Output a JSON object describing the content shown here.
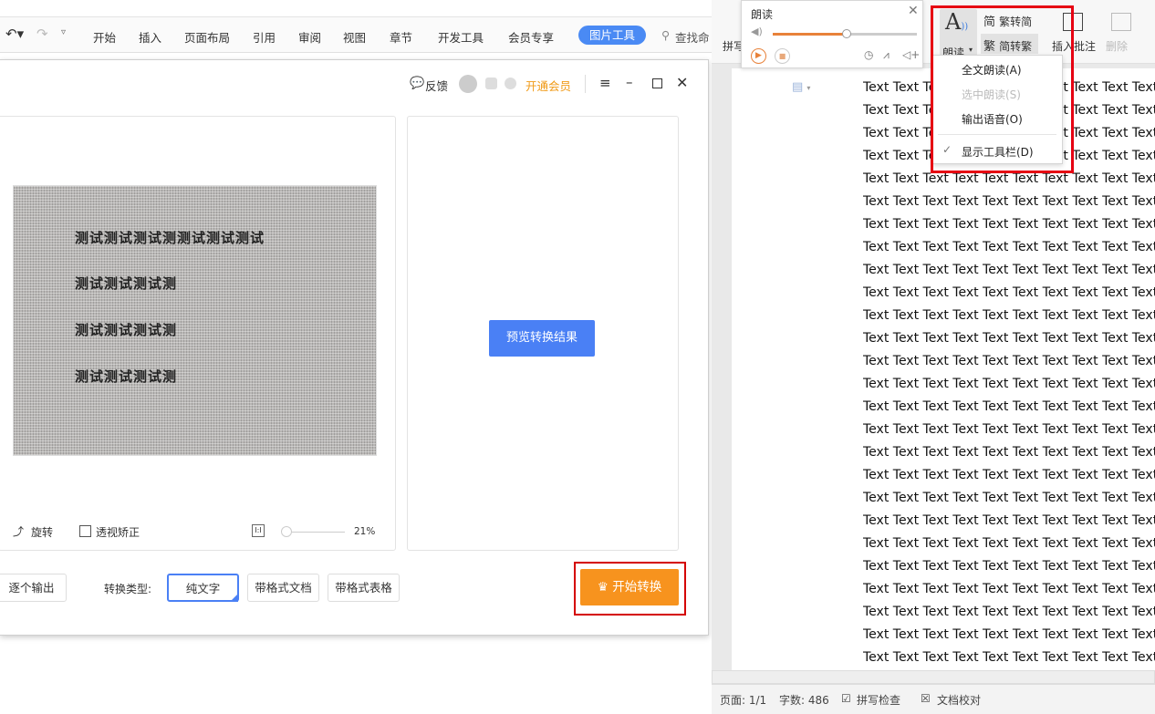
{
  "ribbon": {
    "tabs": [
      "开始",
      "插入",
      "页面布局",
      "引用",
      "审阅",
      "视图",
      "章节",
      "开发工具",
      "会员专享"
    ],
    "active_tab": "图片工具",
    "search": "查找命",
    "partial_label": "拼写"
  },
  "dialog": {
    "feedback": "反馈",
    "vip": "开通会员",
    "preview_button": "预览转换结果",
    "photo_lines": [
      "测试测试测试测测试测试测试",
      "测试测试测试测",
      "测试测试测试测",
      "测试测试测试测"
    ],
    "rotate": "旋转",
    "perspective": "透视矫正",
    "zoom": "21%",
    "export_each": "逐个输出",
    "type_label": "转换类型:",
    "types": [
      "纯文字",
      "带格式文档",
      "带格式表格"
    ],
    "selected_type": "纯文字",
    "start": "开始转换"
  },
  "read_panel": {
    "title": "朗读",
    "volume_percent": 51
  },
  "ribbon_right": {
    "read": "朗读",
    "trad_to_simp": "繁转简",
    "simp_to_trad": "简转繁",
    "insert_comment": "插入批注",
    "delete": "删除"
  },
  "read_menu": {
    "items": [
      "全文朗读(A)",
      "选中朗读(S)",
      "输出语音(O)",
      "显示工具栏(D)"
    ]
  },
  "document": {
    "line_text": "Text Text Text Text Text Text Text Text Text Text Text",
    "line_count": 26
  },
  "status": {
    "page": "页面: 1/1",
    "words": "字数: 486",
    "spell": "拼写检查",
    "proof": "文档校对"
  },
  "colors": {
    "accent": "#4a8af4",
    "orange": "#f7931e",
    "highlight": "#e60012"
  }
}
